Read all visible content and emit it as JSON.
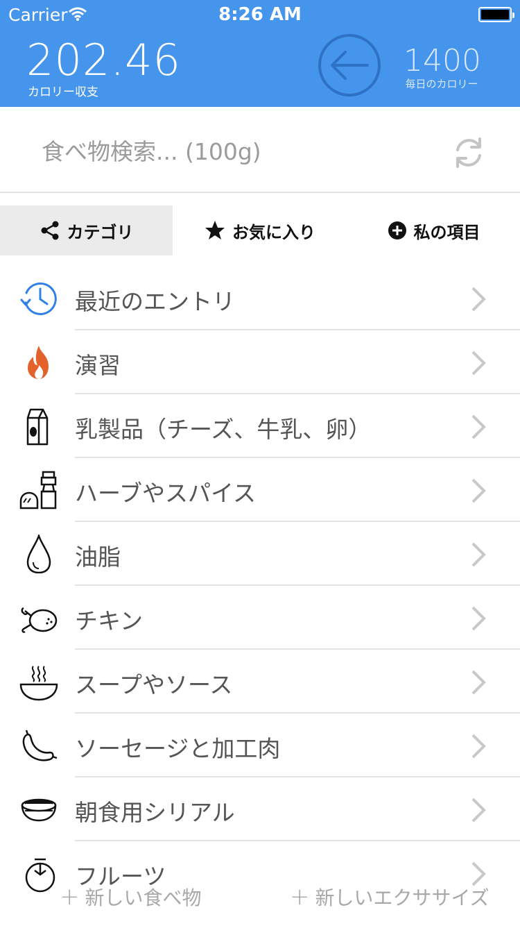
{
  "status": {
    "carrier": "Carrier",
    "time": "8:26 AM"
  },
  "header": {
    "balance_value": "202.46",
    "balance_label": "カロリー収支",
    "daily_value": "1400",
    "daily_label": "毎日のカロリー"
  },
  "search": {
    "placeholder": "食べ物検索... (100g)"
  },
  "tabs": [
    {
      "label": "カテゴリ",
      "icon": "share-icon",
      "active": true
    },
    {
      "label": "お気に入り",
      "icon": "star-icon",
      "active": false
    },
    {
      "label": "私の項目",
      "icon": "plus-circle-icon",
      "active": false
    }
  ],
  "categories": [
    {
      "label": "最近のエントリ",
      "icon": "clock-history-icon"
    },
    {
      "label": "演習",
      "icon": "flame-icon"
    },
    {
      "label": "乳製品（チーズ、牛乳、卵）",
      "icon": "milk-carton-icon"
    },
    {
      "label": "ハーブやスパイス",
      "icon": "spice-shaker-icon"
    },
    {
      "label": "油脂",
      "icon": "oil-drop-icon"
    },
    {
      "label": "チキン",
      "icon": "chicken-icon"
    },
    {
      "label": "スープやソース",
      "icon": "soup-bowl-icon"
    },
    {
      "label": "ソーセージと加工肉",
      "icon": "sausage-icon"
    },
    {
      "label": "朝食用シリアル",
      "icon": "cereal-bowl-icon"
    },
    {
      "label": "フルーツ",
      "icon": "fruit-icon"
    }
  ],
  "bottom": {
    "new_food": "新しい食べ物",
    "new_exercise": "新しいエクササイズ"
  },
  "colors": {
    "header_bg": "#4695ec",
    "clock_blue": "#2f80e8",
    "flame_orange": "#e2622a"
  }
}
